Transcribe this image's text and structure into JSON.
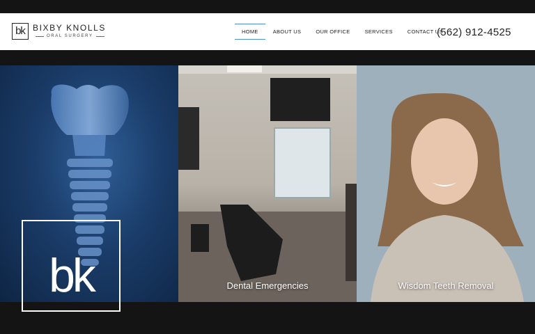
{
  "header": {
    "logo_mark": "bk",
    "logo_name": "BIXBY KNOLLS",
    "logo_sub": "ORAL SURGERY",
    "nav": [
      {
        "label": "HOME",
        "active": true
      },
      {
        "label": "ABOUT US",
        "active": false
      },
      {
        "label": "OUR OFFICE",
        "active": false
      },
      {
        "label": "SERVICES",
        "active": false
      },
      {
        "label": "CONTACT US",
        "active": false
      }
    ],
    "phone": "(562) 912-4525"
  },
  "panels": [
    {
      "label": "",
      "image": "dental-implant-xray"
    },
    {
      "label": "Dental Emergencies",
      "image": "dental-operatory-room"
    },
    {
      "label": "Wisdom Teeth Removal",
      "image": "smiling-woman"
    }
  ],
  "overlay_logo": "bk",
  "colors": {
    "accent": "#4a90d9",
    "dark": "#141414"
  }
}
